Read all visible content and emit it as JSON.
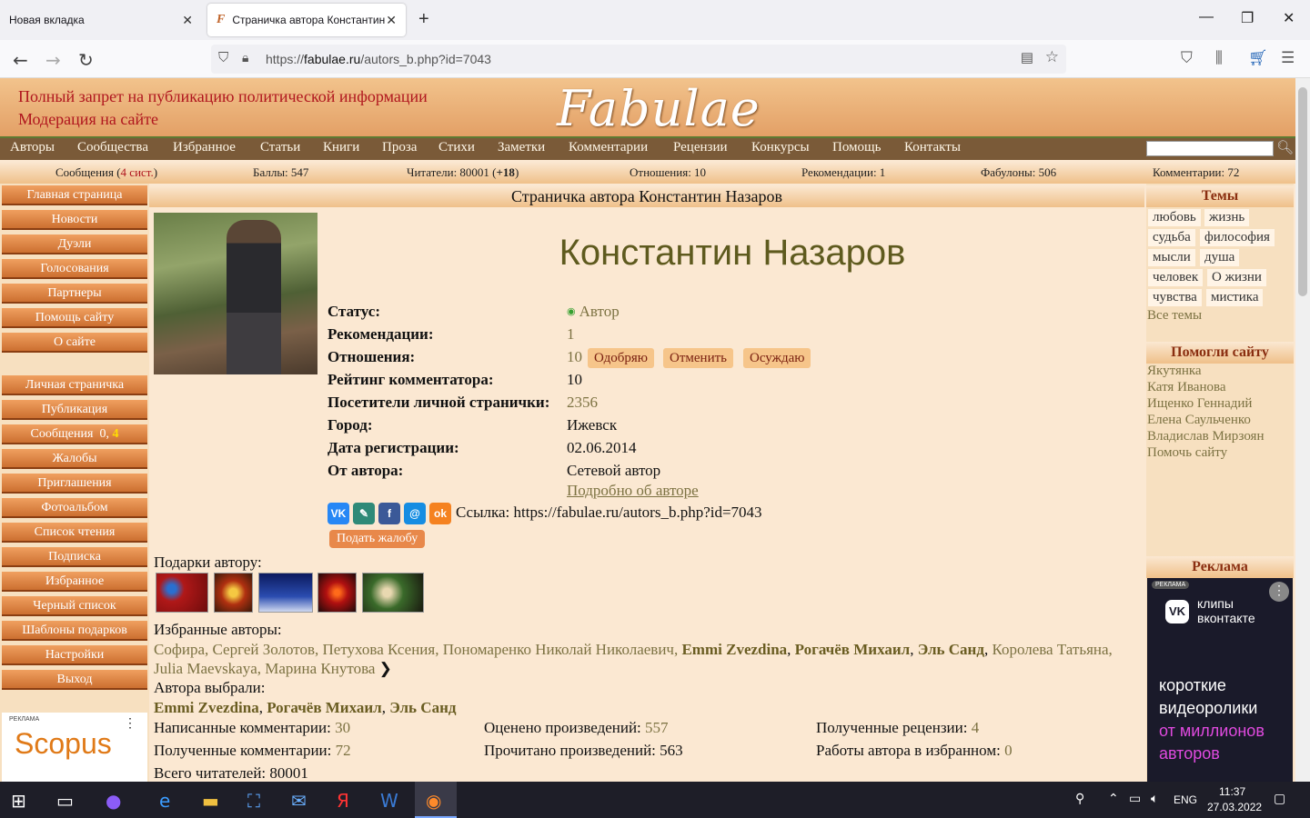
{
  "browser": {
    "tabs": [
      {
        "label": "Новая вкладка"
      },
      {
        "label": "Страничка автора Константин Назаров"
      }
    ],
    "url_prefix": "https://",
    "url_domain": "fabulae.ru",
    "url_path": "/autors_b.php?id=7043"
  },
  "header": {
    "notice1": "Полный запрет на публикацию политической информации",
    "notice2": "Модерация на сайте",
    "logo": "Fabulae"
  },
  "menu": [
    "Авторы",
    "Сообщества",
    "Избранное",
    "Статьи",
    "Книги",
    "Проза",
    "Стихи",
    "Заметки",
    "Комментарии",
    "Рецензии",
    "Конкурсы",
    "Помощь",
    "Контакты"
  ],
  "stats": {
    "messages_label": "Сообщения (",
    "messages_sys": "4 сист.",
    "messages_end": ")",
    "points": "Баллы: 547",
    "readers_label": "Читатели: 80001 (",
    "readers_delta": "+18",
    "readers_end": ")",
    "relations": "Отношения: 10",
    "recommendations": "Рекомендации: 1",
    "fabulons": "Фабулоны: 506",
    "comments": "Комментарии: 72"
  },
  "left_menu": {
    "group1": [
      "Главная страница",
      "Новости",
      "Дуэли",
      "Голосования",
      "Партнеры",
      "Помощь сайту",
      "О сайте"
    ],
    "group2": [
      "Личная страничка",
      "Публикация",
      "Сообщения",
      "Жалобы",
      "Приглашения",
      "Фотоальбом",
      "Список чтения",
      "Подписка",
      "Избранное",
      "Черный список",
      "Шаблоны подарков",
      "Настройки",
      "Выход"
    ],
    "messages_count_a": "0",
    "messages_count_b": "4",
    "ad_label": "РЕКЛАМА",
    "ad_brand": "Scopus"
  },
  "profile": {
    "page_title": "Страничка автора Константин Назаров",
    "name": "Константин Назаров",
    "labels": {
      "status": "Статус:",
      "recommendations": "Рекомендации:",
      "relations": "Отношения:",
      "comment_rating": "Рейтинг комментатора:",
      "visitors": "Посетители личной странички:",
      "city": "Город:",
      "registered": "Дата регистрации:",
      "from_author": "От автора:"
    },
    "values": {
      "status": "Автор",
      "recommendations": "1",
      "relations": "10",
      "comment_rating": "10",
      "visitors": "2356",
      "city": "Ижевск",
      "registered": "02.06.2014",
      "from_author": "Сетевой автор",
      "more_link": "Подробно об авторе"
    },
    "relation_buttons": [
      "Одобряю",
      "Отменить",
      "Осуждаю"
    ],
    "share_link": "Ссылка: https://fabulae.ru/autors_b.php?id=7043",
    "complaint_button": "Подать жалобу",
    "gifts_label": "Подарки автору:",
    "favorites_label": "Избранные авторы:",
    "favorites_line1_plain": "Софира, Сергей Золотов, Петухова Ксения, Пономаренко Николай Николаевич, ",
    "favorites_bold1": "Emmi Zvezdina",
    "favorites_bold2": "Рогачёв Михаил",
    "favorites_bold3": "Эль Санд",
    "favorites_rest": "Королева Татьяна, Julia Maevskaya, Марина Кнутова",
    "chosen_label": "Автора выбрали:",
    "chosen": [
      "Emmi Zvezdina",
      "Рогачёв Михаил",
      "Эль Санд"
    ],
    "written_comments_label": "Написанные комментарии: ",
    "written_comments": "30",
    "rated_label": "Оценено произведений: ",
    "rated": "557",
    "reviews_label": "Полученные рецензии: ",
    "reviews": "4",
    "received_comments_label": "Полученные комментарии: ",
    "received_comments": "72",
    "read_label": "Прочитано произведений: ",
    "read": "563",
    "in_favorites_label": "Работы автора в избранном: ",
    "in_favorites": "0",
    "total_readers": "Всего читателей: 80001"
  },
  "right_col": {
    "topics_title": "Темы",
    "topics": [
      "любовь",
      "жизнь",
      "судьба",
      "философия",
      "мысли",
      "душа",
      "человек",
      "О жизни",
      "чувства",
      "мистика"
    ],
    "all_topics": "Все темы",
    "helped_title": "Помогли сайту",
    "helpers": [
      "Якутянка",
      "Катя Иванова",
      "Ищенко Геннадий",
      "Елена Саульченко",
      "Владислав Мирзоян",
      "Помочь сайту"
    ],
    "ad_title": "Реклама",
    "ad_label": "РЕКЛАМА",
    "ad_brand_line1": "клипы",
    "ad_brand_line2": "вконтакте",
    "ad_copy1": "короткие",
    "ad_copy2": "видеоролики",
    "ad_copy3": "от миллионов",
    "ad_copy4": "авторов"
  },
  "taskbar": {
    "lang": "ENG",
    "time": "11:37",
    "date": "27.03.2022"
  }
}
